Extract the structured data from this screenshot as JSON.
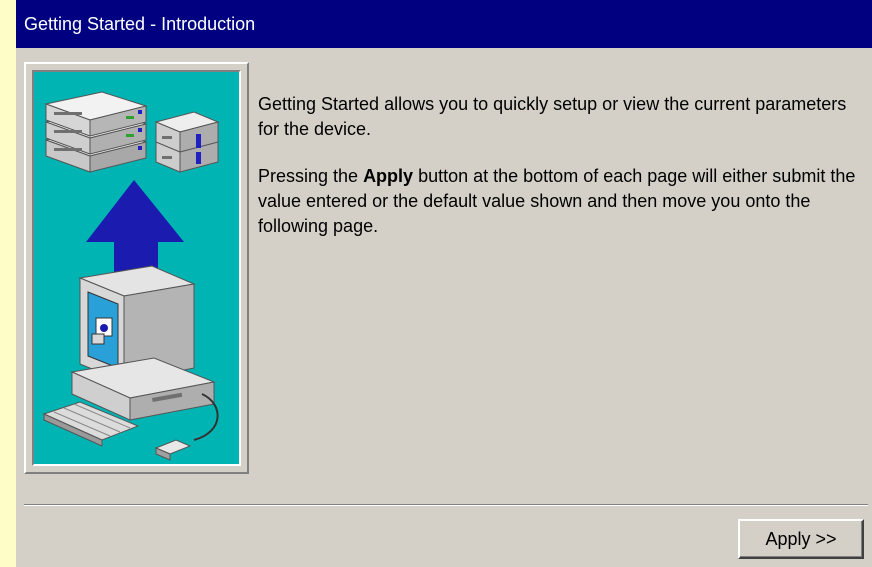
{
  "window": {
    "title": "Getting Started - Introduction"
  },
  "intro": {
    "paragraph1": "Getting Started allows you to quickly setup or view the current parameters for the device.",
    "paragraph2_before": "Pressing the ",
    "paragraph2_bold": "Apply",
    "paragraph2_after": " button at the bottom of each page will either submit the value entered or the default value shown and then move you onto the following page."
  },
  "footer": {
    "apply_label": "Apply >>"
  },
  "colors": {
    "titlebar": "#000080",
    "window_bg": "#d4d0c8",
    "illustration_bg": "#00b4b4",
    "arrow": "#1b1bb0"
  },
  "icons": {
    "illustration": "network-setup-illustration"
  }
}
